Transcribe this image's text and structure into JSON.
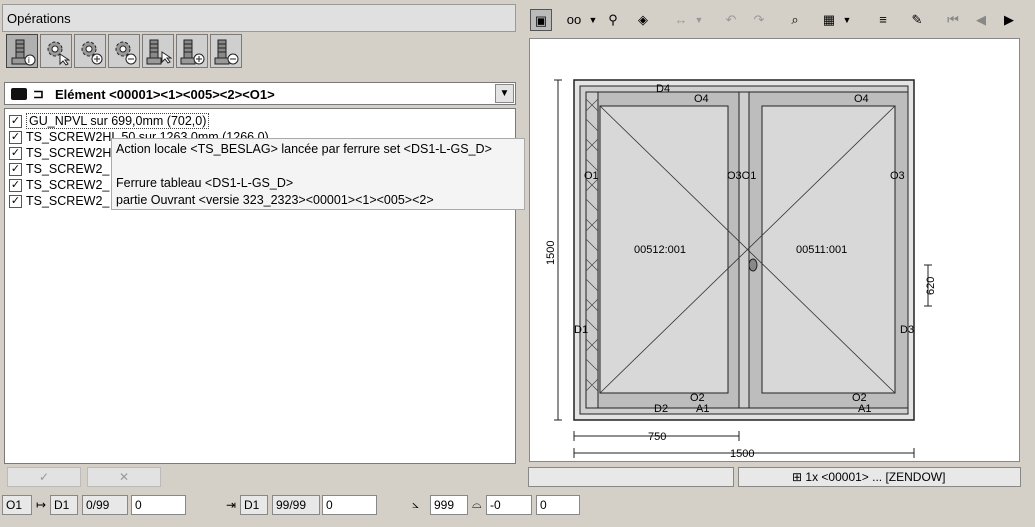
{
  "left": {
    "title": "Opérations",
    "ops_icons": [
      "screw-info-icon",
      "gear-cursor-icon",
      "gear-add-icon",
      "gear-remove-icon",
      "screw-cursor-icon",
      "screw-add-icon",
      "screw-remove-icon"
    ],
    "element": {
      "label": "Elément <00001><1><005><2><O1>"
    },
    "list": [
      {
        "text": "GU_NPVL sur 699,0mm (702,0)",
        "checked": true
      },
      {
        "text": "TS_SCREW2HL 50 sur 1263,0mm (1266,0)",
        "checked": true
      },
      {
        "text": "TS_SCREW2H",
        "checked": true
      },
      {
        "text": "TS_SCREW2_",
        "checked": true
      },
      {
        "text": "TS_SCREW2_",
        "checked": true
      },
      {
        "text": "TS_SCREW2_",
        "checked": true
      }
    ],
    "tooltip": {
      "line1": "Action locale <TS_BESLAG> lancée par ferrure set <DS1-L-GS_D>",
      "line2": "Ferrure tableau <DS1-L-GS_D>",
      "line3": "partie Ouvrant <versie 323_2323><00001><1><005><2>"
    },
    "buttons": {
      "ok": "✓",
      "cancel": "✕"
    }
  },
  "status": {
    "o1": "O1",
    "d1a": "D1",
    "frac1": "0/99",
    "val1": "0",
    "d1b": "D1",
    "frac2": "99/99",
    "val2": "0",
    "angle1": "999",
    "angle2": "-0",
    "val3": "0"
  },
  "right": {
    "drawing": {
      "dim_height": "1500",
      "dim_width_total": "1500",
      "dim_width_half": "750",
      "dim_handle": "620",
      "labels": {
        "d4": "D4",
        "o4l": "O4",
        "o4r": "O4",
        "o1": "O1",
        "o3": "O3",
        "d1": "D1",
        "d3": "D3",
        "d2": "D2",
        "a1l": "A1",
        "a1r": "A1",
        "o2l": "O2",
        "o2r": "O2",
        "center": "O3O1",
        "sash_left": "00512:001",
        "sash_right": "00511:001"
      }
    },
    "status_text": "1x <00001> ... [ZENDOW]"
  }
}
